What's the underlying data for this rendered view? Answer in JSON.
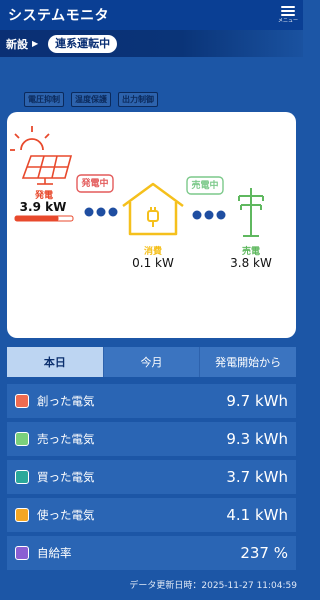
{
  "header": {
    "title": "システムモニタ",
    "menu_label": "メニュー"
  },
  "subbar": {
    "device": "新設",
    "arrow": "▶",
    "mode": "連系運転中"
  },
  "controls": [
    "電圧抑制",
    "温度保護",
    "出力制御"
  ],
  "flow": {
    "solar_label": "発電",
    "solar_value": "3.9 kW",
    "solar_bar_fraction": 0.75,
    "badge_left": "発電中",
    "badge_right": "売電中",
    "home_label": "消費",
    "home_value": "0.1 kW",
    "grid_label": "売電",
    "grid_value": "3.8 kW"
  },
  "tabs": [
    {
      "label": "本日",
      "active": true
    },
    {
      "label": "今月",
      "active": false
    },
    {
      "label": "発電開始から",
      "active": false
    }
  ],
  "stats": [
    {
      "label": "創った電気",
      "value": "9.7 kWh",
      "color": "#ef6b50"
    },
    {
      "label": "売った電気",
      "value": "9.3 kWh",
      "color": "#7ad07c"
    },
    {
      "label": "買った電気",
      "value": "3.7 kWh",
      "color": "#2aa89a"
    },
    {
      "label": "使った電気",
      "value": "4.1 kWh",
      "color": "#f4a623"
    },
    {
      "label": "自給率",
      "value": "237 %",
      "color": "#8a5fd3"
    }
  ],
  "footer": "データ更新日時：2025-11-27 11:04:59",
  "colors": {
    "header_bg": "#0a3f94",
    "solar": "#e8492c",
    "badge_left": "#e35a5a",
    "badge_right": "#7cc98a",
    "home": "#f5c01c",
    "grid": "#5fb85f",
    "dots": "#1f4ea1"
  }
}
